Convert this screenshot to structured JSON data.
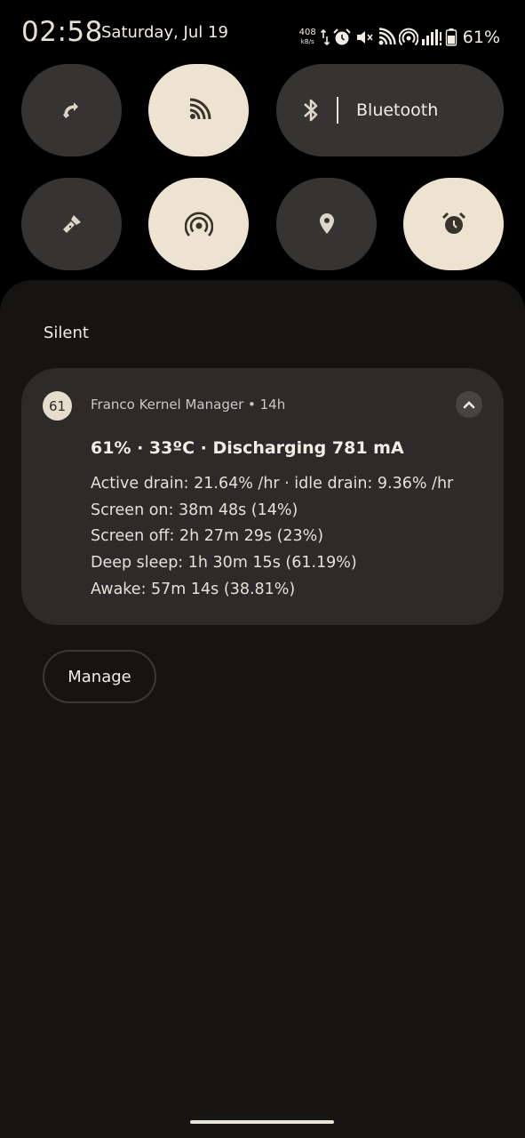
{
  "status_bar": {
    "time": "02:58",
    "date": "Saturday, Jul 19",
    "net_speed": "408",
    "net_speed_unit": "kB/s",
    "battery_percent": "61%",
    "icons": [
      "data-transfer-icon",
      "alarm-icon",
      "mute-icon",
      "cast-icon",
      "hotspot-icon",
      "signal-icon",
      "battery-icon"
    ]
  },
  "quick_settings": {
    "tiles": [
      {
        "name": "auto-rotate",
        "icon": "rotate-icon",
        "active": false
      },
      {
        "name": "cast",
        "icon": "cast-icon",
        "active": true
      },
      {
        "name": "bluetooth",
        "icon": "bluetooth-icon",
        "label": "Bluetooth",
        "active": false
      },
      {
        "name": "flashlight",
        "icon": "flashlight-icon",
        "active": false
      },
      {
        "name": "hotspot",
        "icon": "hotspot-icon",
        "active": true
      },
      {
        "name": "location",
        "icon": "location-icon",
        "active": false
      },
      {
        "name": "alarm",
        "icon": "alarm-icon",
        "active": true
      }
    ]
  },
  "colors": {
    "tile_off": "#353432",
    "tile_on": "#ede3d0",
    "shade": "#151413",
    "card": "#2c2b29"
  },
  "notifications": {
    "section_title": "Silent",
    "items": [
      {
        "icon_text": "61",
        "app_line": "Franco Kernel Manager • 14h",
        "title": "61% · 33ºC · Discharging 781 mA",
        "lines": [
          "Active drain: 21.64% /hr · idle drain: 9.36% /hr",
          "Screen on: 38m 48s (14%)",
          "Screen off: 2h 27m 29s (23%)",
          "Deep sleep: 1h 30m 15s (61.19%)",
          "Awake: 57m 14s (38.81%)"
        ]
      }
    ],
    "manage_label": "Manage"
  }
}
